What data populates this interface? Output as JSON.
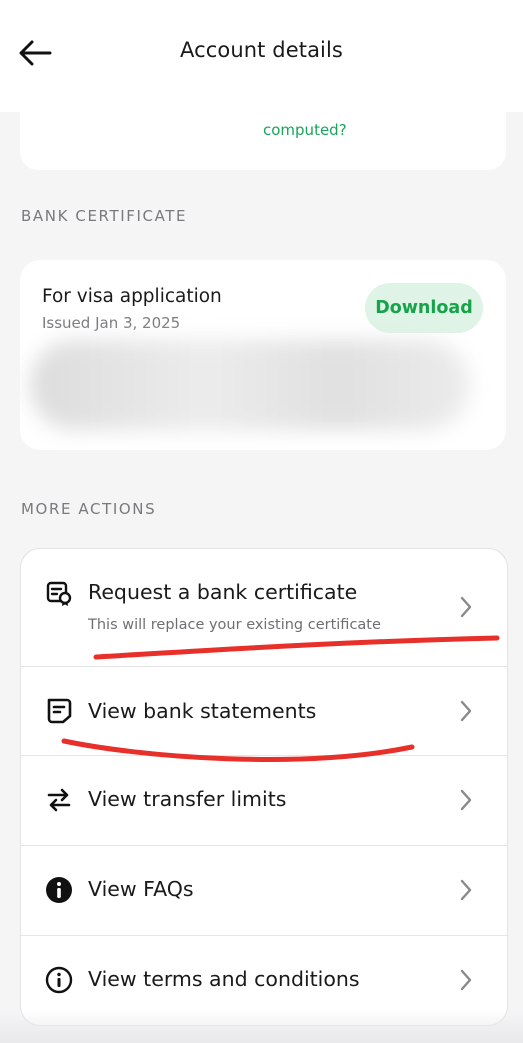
{
  "header": {
    "title": "Account details"
  },
  "top_card": {
    "link_text": "computed?"
  },
  "sections": {
    "certificate_label": "BANK CERTIFICATE",
    "more_actions_label": "MORE ACTIONS"
  },
  "certificate": {
    "title": "For visa application",
    "issued": "Issued Jan 3, 2025",
    "download_label": "Download"
  },
  "actions": [
    {
      "label": "Request a bank certificate",
      "subtitle": "This will replace your existing certificate",
      "icon": "certificate-icon"
    },
    {
      "label": "View bank statements",
      "icon": "statement-icon"
    },
    {
      "label": "View transfer limits",
      "icon": "transfer-arrows-icon"
    },
    {
      "label": "View FAQs",
      "icon": "info-filled-icon"
    },
    {
      "label": "View terms and conditions",
      "icon": "info-outline-icon"
    }
  ],
  "colors": {
    "accent_green": "#16a34a",
    "download_bg": "#dff4e6",
    "annotation_red": "#e8302a",
    "page_bg": "#f5f5f6"
  }
}
